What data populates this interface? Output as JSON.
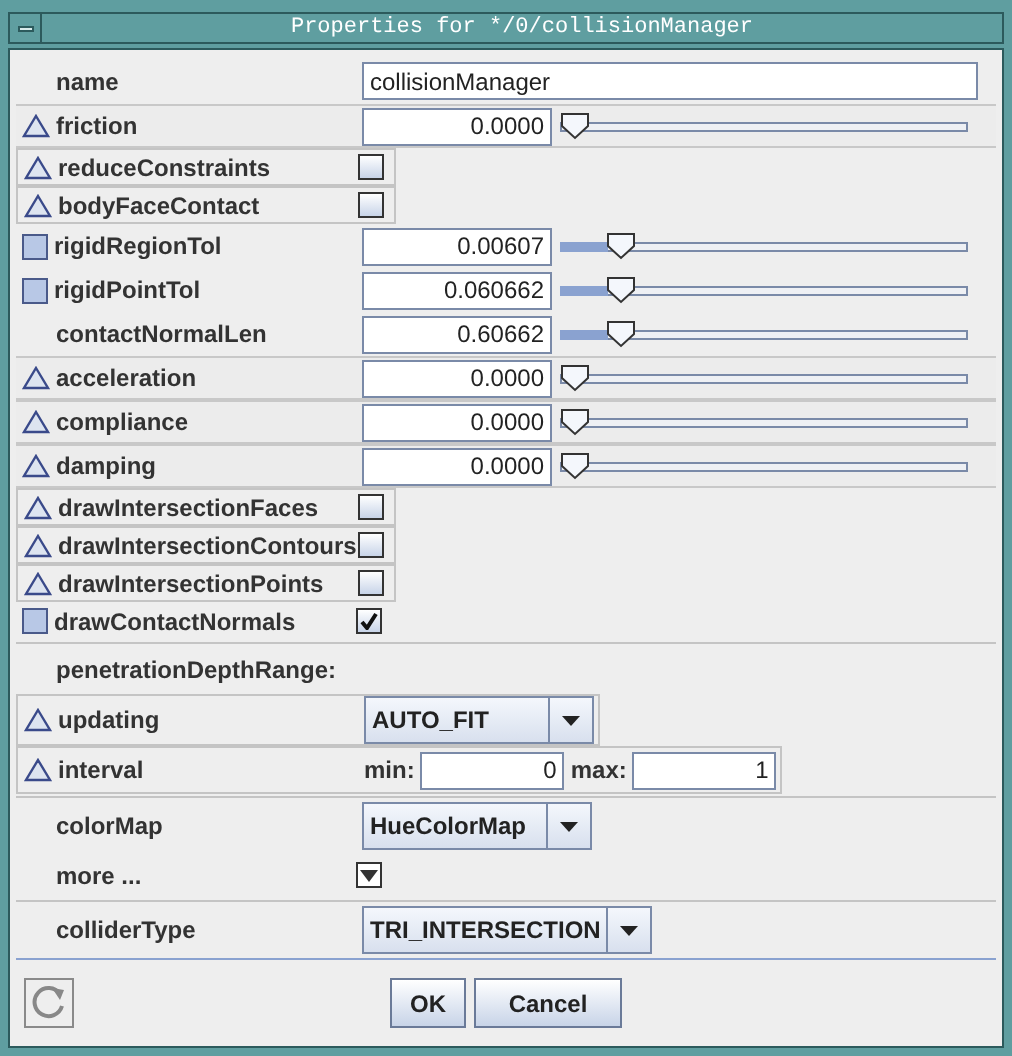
{
  "window": {
    "title": "Properties for */0/collisionManager"
  },
  "sections": [
    {
      "rows": [
        {
          "kind": "text",
          "inherited": false,
          "explicit": false,
          "label": "name",
          "value": "collisionManager"
        },
        {
          "kind": "slider",
          "inherited": true,
          "explicit": false,
          "label": "friction",
          "value": "0.0000",
          "level": 0
        },
        {
          "kind": "checkbox",
          "inherited": true,
          "explicit": false,
          "label": "reduceConstraints",
          "checked": false
        },
        {
          "kind": "checkbox",
          "inherited": true,
          "explicit": false,
          "label": "bodyFaceContact",
          "checked": false
        },
        {
          "kind": "slider",
          "inherited": false,
          "explicit": true,
          "label": "rigidRegionTol",
          "value": "0.00607",
          "level": 0.12
        },
        {
          "kind": "slider",
          "inherited": false,
          "explicit": true,
          "label": "rigidPointTol",
          "value": "0.060662",
          "level": 0.12
        },
        {
          "kind": "slider",
          "inherited": false,
          "explicit": false,
          "label": "contactNormalLen",
          "value": "0.60662",
          "level": 0.12
        },
        {
          "kind": "slider",
          "inherited": true,
          "explicit": false,
          "label": "acceleration",
          "value": "0.0000",
          "level": 0
        },
        {
          "kind": "slider",
          "inherited": true,
          "explicit": false,
          "label": "compliance",
          "value": "0.0000",
          "level": 0
        },
        {
          "kind": "slider",
          "inherited": true,
          "explicit": false,
          "label": "damping",
          "value": "0.0000",
          "level": 0
        },
        {
          "kind": "checkbox",
          "inherited": true,
          "explicit": false,
          "label": "drawIntersectionFaces",
          "checked": false
        },
        {
          "kind": "checkbox",
          "inherited": true,
          "explicit": false,
          "label": "drawIntersectionContours",
          "checked": false
        },
        {
          "kind": "checkbox",
          "inherited": true,
          "explicit": false,
          "label": "drawIntersectionPoints",
          "checked": false
        },
        {
          "kind": "checkbox",
          "inherited": false,
          "explicit": true,
          "label": "drawContactNormals",
          "checked": true
        }
      ]
    },
    {
      "rows": [
        {
          "kind": "heading",
          "inherited": false,
          "explicit": false,
          "label": "penetrationDepthRange:"
        },
        {
          "kind": "combo",
          "inherited": true,
          "explicit": false,
          "label": "updating",
          "value": "AUTO_FIT"
        },
        {
          "kind": "interval",
          "inherited": true,
          "explicit": false,
          "label": "interval",
          "min_label": "min:",
          "min": "0",
          "max_label": "max:",
          "max": "1"
        }
      ]
    },
    {
      "rows": [
        {
          "kind": "combo",
          "inherited": false,
          "explicit": false,
          "label": "colorMap",
          "value": "HueColorMap"
        },
        {
          "kind": "expander",
          "inherited": false,
          "explicit": false,
          "label": "more ..."
        }
      ]
    },
    {
      "rows": [
        {
          "kind": "combo",
          "inherited": false,
          "explicit": false,
          "label": "colliderType",
          "value": "TRI_INTERSECTION"
        }
      ]
    }
  ],
  "buttons": [
    "OK",
    "Cancel"
  ]
}
